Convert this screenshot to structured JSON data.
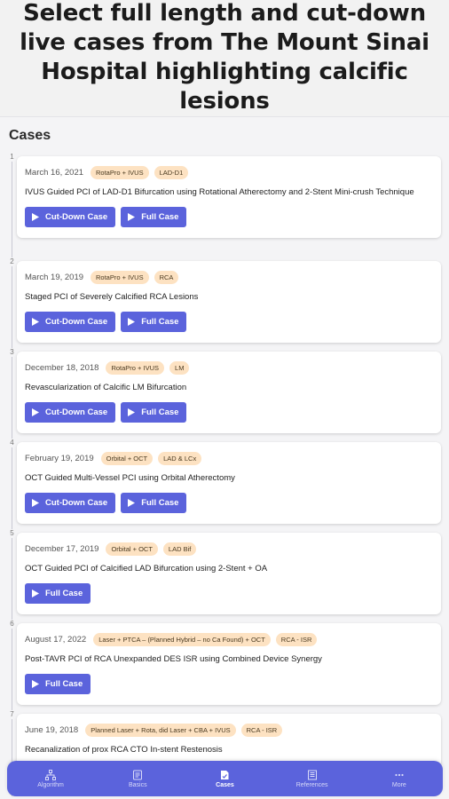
{
  "promo": {
    "title": "Select full length and cut-down live cases from The Mount Sinai Hospital highlighting calcific lesions"
  },
  "section_title": "Cases",
  "cases": [
    {
      "num": "1",
      "date": "March 16, 2021",
      "tags": [
        "RotaPro + IVUS",
        "LAD-D1"
      ],
      "title": "IVUS Guided PCI of LAD-D1 Bifurcation using Rotational Atherectomy and 2-Stent Mini-crush Technique",
      "buttons": [
        "Cut-Down Case",
        "Full Case"
      ]
    },
    {
      "num": "2",
      "date": "March 19, 2019",
      "tags": [
        "RotaPro + IVUS",
        "RCA"
      ],
      "title": "Staged PCI of Severely Calcified RCA Lesions",
      "buttons": [
        "Cut-Down Case",
        "Full Case"
      ]
    },
    {
      "num": "3",
      "date": "December 18, 2018",
      "tags": [
        "RotaPro + IVUS",
        "LM"
      ],
      "title": "Revascularization of Calcific LM Bifurcation",
      "buttons": [
        "Cut-Down Case",
        "Full Case"
      ]
    },
    {
      "num": "4",
      "date": "February 19, 2019",
      "tags": [
        "Orbital + OCT",
        "LAD & LCx"
      ],
      "title": "OCT Guided Multi-Vessel PCI using Orbital Atherectomy",
      "buttons": [
        "Cut-Down Case",
        "Full Case"
      ]
    },
    {
      "num": "5",
      "date": "December 17, 2019",
      "tags": [
        "Orbital + OCT",
        "LAD Bif"
      ],
      "title": "OCT Guided PCI of Calcified LAD Bifurcation using 2-Stent + OA",
      "buttons": [
        "Full Case"
      ]
    },
    {
      "num": "6",
      "date": "August 17, 2022",
      "tags": [
        "Laser + PTCA – (Planned Hybrid – no Ca Found) + OCT",
        "RCA - ISR"
      ],
      "title": "Post-TAVR PCI of RCA Unexpanded DES ISR using Combined Device Synergy",
      "buttons": [
        "Full Case"
      ]
    },
    {
      "num": "7",
      "date": "June 19, 2018",
      "tags": [
        "Planned Laser + Rota, did Laser + CBA + IVUS",
        "RCA - ISR"
      ],
      "title": "Recanalization of prox RCA CTO In-stent Restenosis",
      "buttons": []
    }
  ],
  "nav": {
    "items": [
      {
        "label": "Algorithm",
        "icon": "algorithm-icon"
      },
      {
        "label": "Basics",
        "icon": "basics-icon"
      },
      {
        "label": "Cases",
        "icon": "cases-icon"
      },
      {
        "label": "References",
        "icon": "references-icon"
      },
      {
        "label": "More",
        "icon": "more-icon"
      }
    ],
    "active": "Cases"
  },
  "colors": {
    "accent": "#5b63dc",
    "tag_bg": "#fde2c2",
    "background": "#f4f4f6"
  }
}
